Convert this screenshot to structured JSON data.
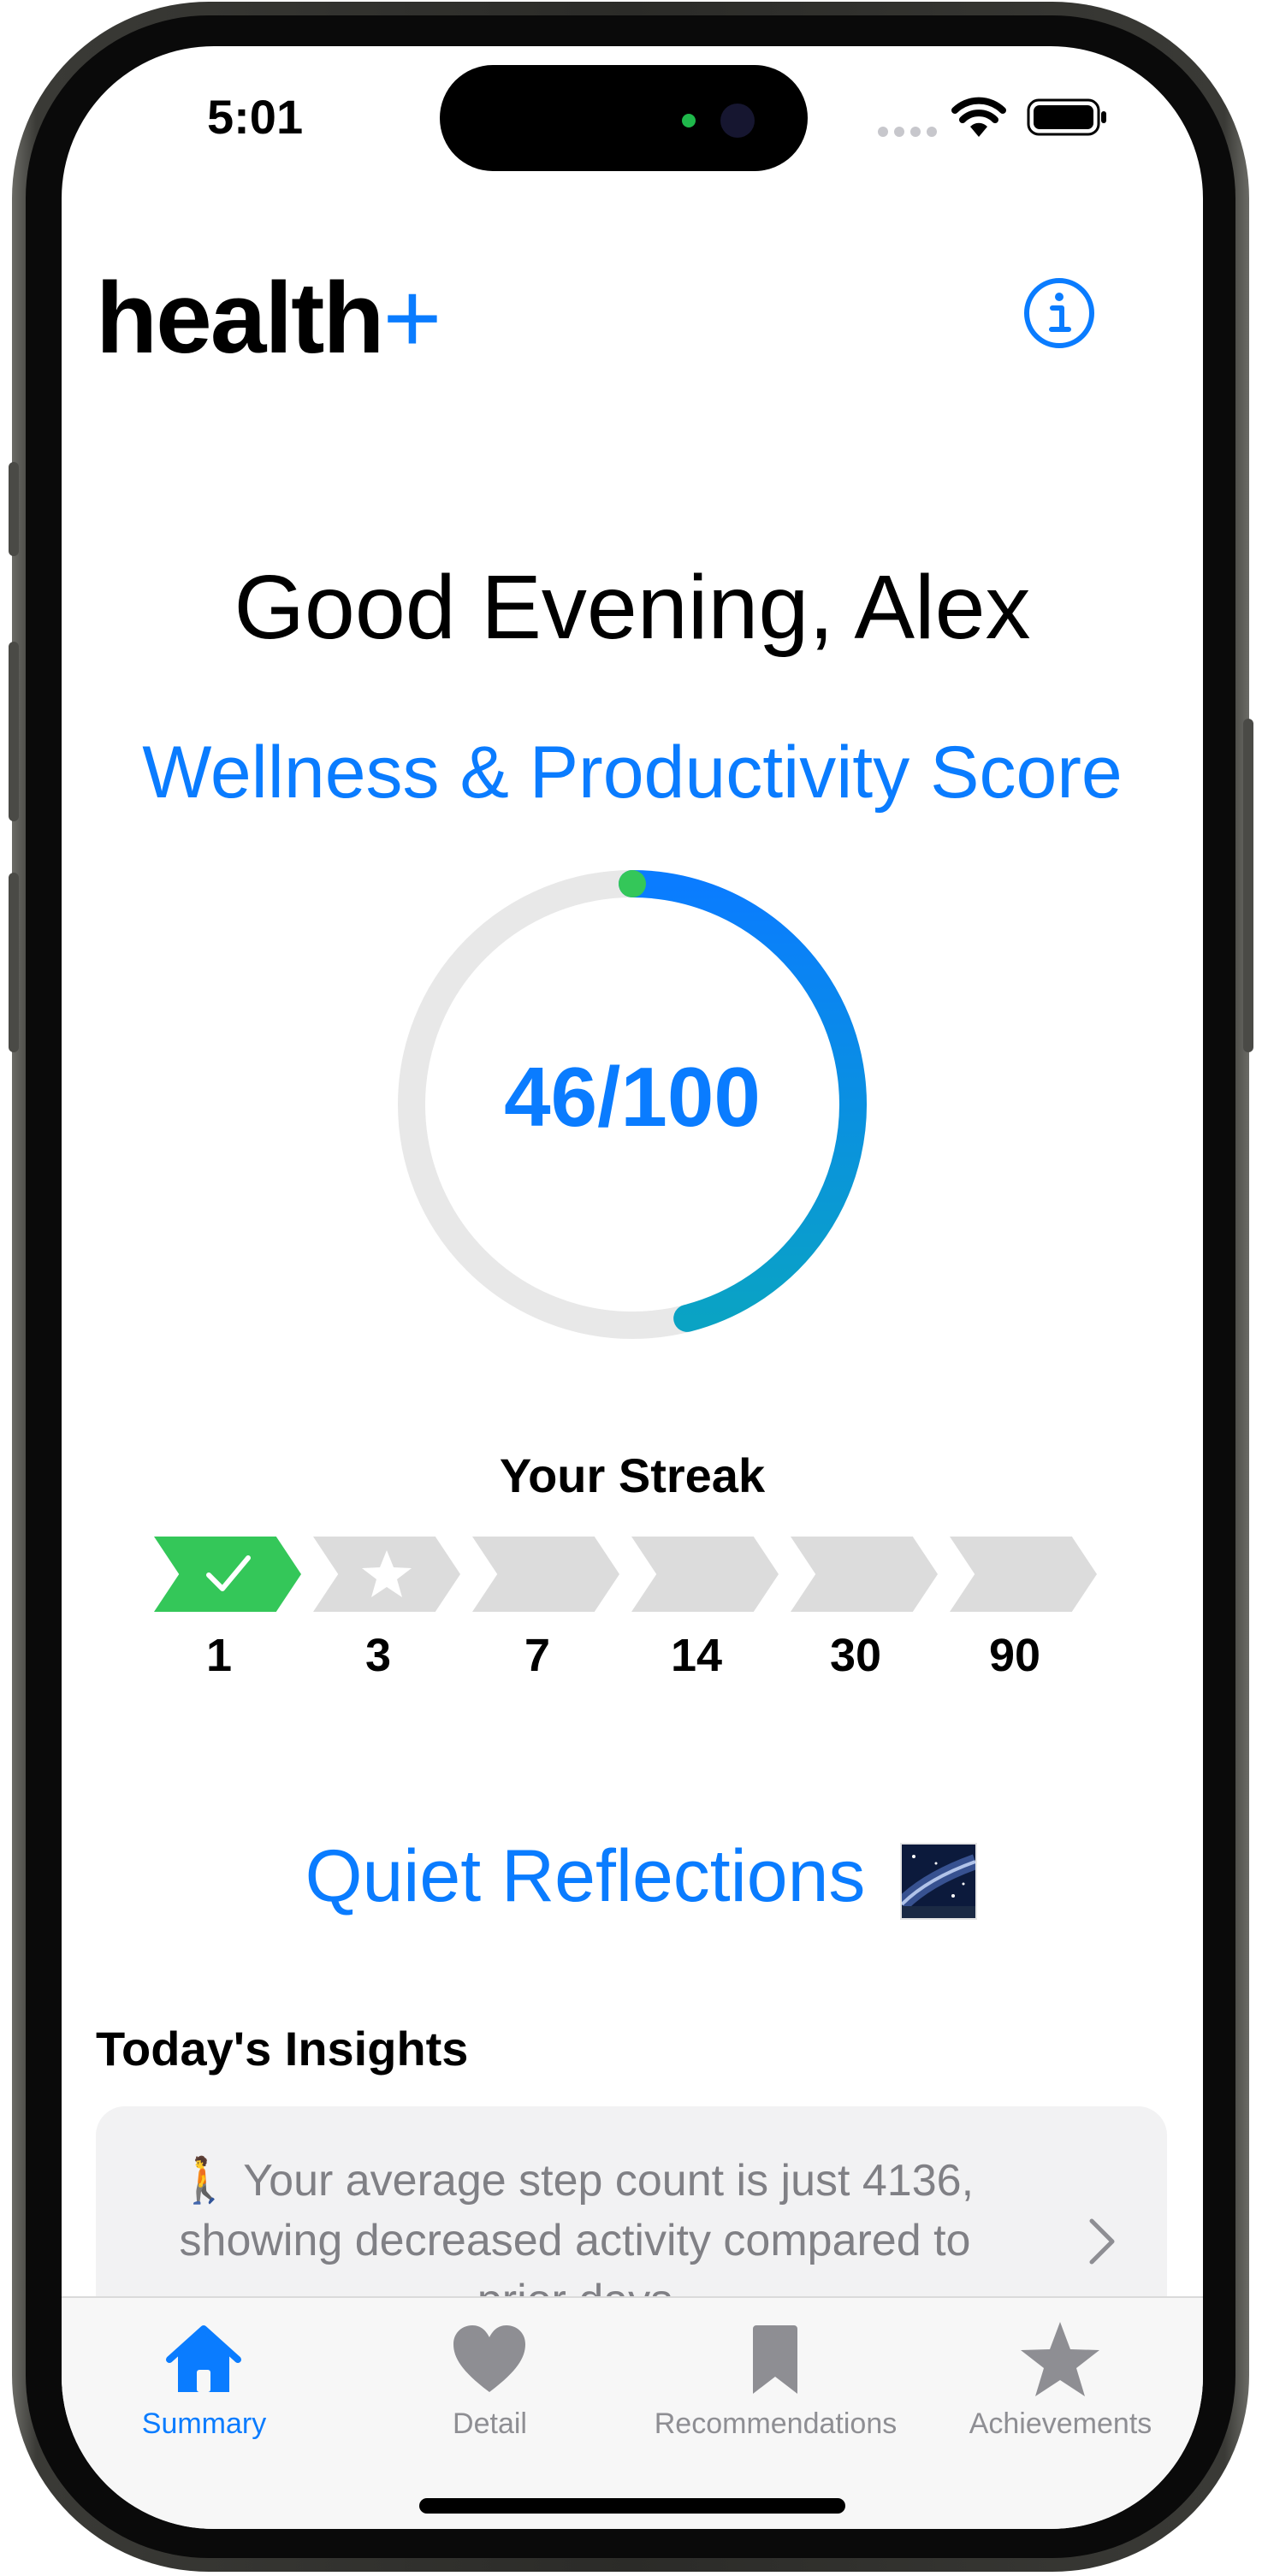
{
  "status_bar": {
    "time": "5:01"
  },
  "header": {
    "brand_main": "health",
    "brand_accent": "+",
    "info_icon": "info-circle-icon"
  },
  "greeting": "Good Evening, Alex",
  "score": {
    "title": "Wellness & Productivity Score",
    "value": 46,
    "max": 100,
    "display": "46/100"
  },
  "streak": {
    "title": "Your Streak",
    "current_step": 1,
    "milestones": [
      {
        "label": "1",
        "icon": "checkmark-icon",
        "completed": true
      },
      {
        "label": "3",
        "icon": "star-icon",
        "completed": false
      },
      {
        "label": "7",
        "icon": "",
        "completed": false
      },
      {
        "label": "14",
        "icon": "",
        "completed": false
      },
      {
        "label": "30",
        "icon": "",
        "completed": false
      },
      {
        "label": "90",
        "icon": "",
        "completed": false
      }
    ]
  },
  "reflections": {
    "title": "Quiet Reflections",
    "emoji_icon": "milky-way-icon"
  },
  "insights": {
    "title": "Today's Insights",
    "card_emoji": "🚶",
    "card_text": "Your average step count is just 4136, showing decreased activity compared to prior days"
  },
  "tabs": [
    {
      "label": "Summary",
      "icon": "house-icon",
      "active": true
    },
    {
      "label": "Detail",
      "icon": "heart-icon",
      "active": false
    },
    {
      "label": "Recommendations",
      "icon": "bookmark-icon",
      "active": false
    },
    {
      "label": "Achievements",
      "icon": "star-icon",
      "active": false
    }
  ],
  "colors": {
    "accent": "#0a7cff",
    "success": "#34c759",
    "ring_end": "#0aa3c4",
    "track": "#e8e8e8"
  }
}
